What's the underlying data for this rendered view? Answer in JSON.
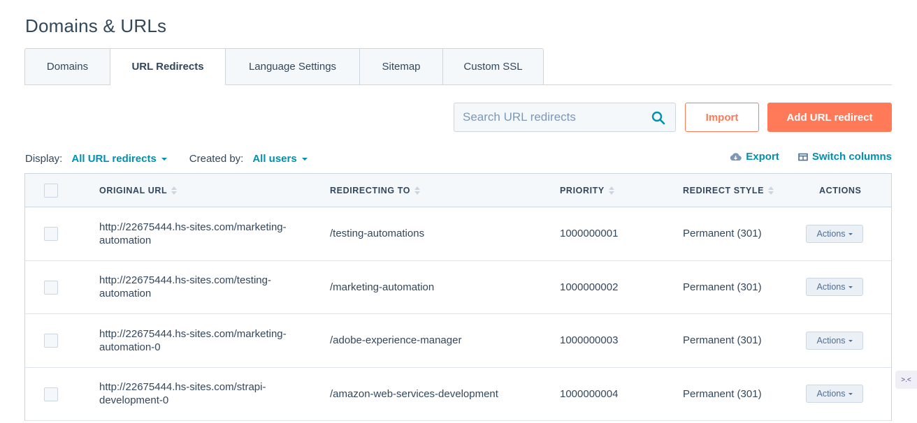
{
  "page": {
    "title": "Domains & URLs"
  },
  "tabs": [
    {
      "label": "Domains",
      "active": false
    },
    {
      "label": "URL Redirects",
      "active": true
    },
    {
      "label": "Language Settings",
      "active": false
    },
    {
      "label": "Sitemap",
      "active": false
    },
    {
      "label": "Custom SSL",
      "active": false
    }
  ],
  "search": {
    "placeholder": "Search URL redirects",
    "icon": "search-icon"
  },
  "buttons": {
    "import": "Import",
    "add": "Add URL redirect"
  },
  "filters": {
    "display_label": "Display:",
    "display_value": "All URL redirects",
    "created_label": "Created by:",
    "created_value": "All users"
  },
  "toolbar": {
    "export": "Export",
    "switch_columns": "Switch columns"
  },
  "table": {
    "columns": [
      "Original URL",
      "Redirecting to",
      "Priority",
      "Redirect style",
      "Actions"
    ],
    "rows": [
      {
        "original": "http://22675444.hs-sites.com/marketing-automation",
        "redirect": "/testing-automations",
        "priority": "1000000001",
        "style": "Permanent (301)",
        "action": "Actions"
      },
      {
        "original": "http://22675444.hs-sites.com/testing-automation",
        "redirect": "/marketing-automation",
        "priority": "1000000002",
        "style": "Permanent (301)",
        "action": "Actions"
      },
      {
        "original": "http://22675444.hs-sites.com/marketing-automation-0",
        "redirect": "/adobe-experience-manager",
        "priority": "1000000003",
        "style": "Permanent (301)",
        "action": "Actions"
      },
      {
        "original": "http://22675444.hs-sites.com/strapi-development-0",
        "redirect": "/amazon-web-services-development",
        "priority": "1000000004",
        "style": "Permanent (301)",
        "action": "Actions"
      }
    ]
  },
  "widget": {
    "glyph": ">.<"
  },
  "colors": {
    "accent": "#ff7a59",
    "link": "#0091ae",
    "text": "#33475b",
    "border": "#cbd6e2"
  }
}
